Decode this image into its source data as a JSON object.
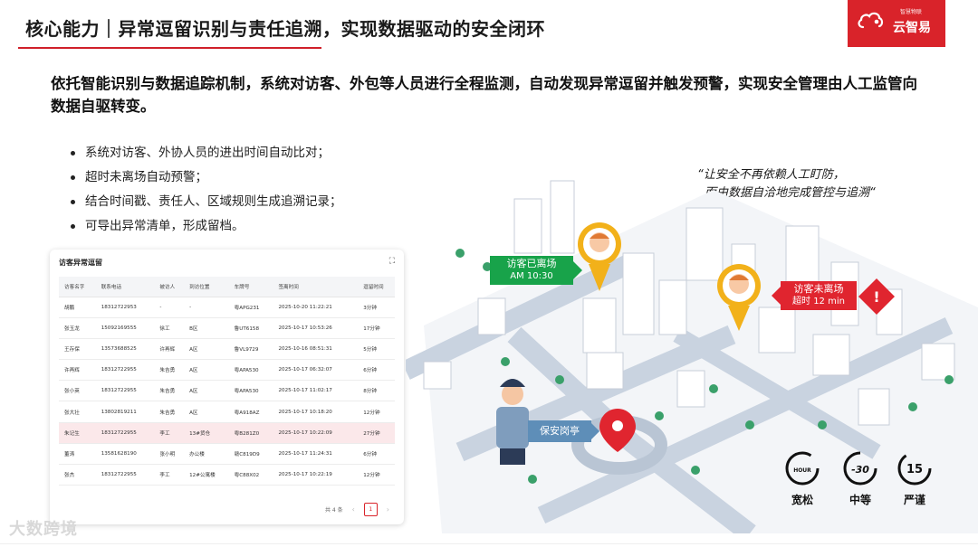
{
  "header": {
    "title": "核心能力｜异常逗留识别与责任追溯，实现数据驱动的安全闭环",
    "logo_tag": "智慧物联",
    "logo_name": "云智易"
  },
  "intro": "依托智能识别与数据追踪机制，系统对访客、外包等人员进行全程监测，自动发现异常逗留并触发预警，实现安全管理由人工监管向数据自驱转变。",
  "bullets": [
    "系统对访客、外协人员的进出时间自动比对；",
    "超时未离场自动预警；",
    "结合时间戳、责任人、区域规则生成追溯记录；",
    "可导出异常清单，形成留档。"
  ],
  "quote": {
    "line1": "“让安全不再依赖人工盯防，",
    "line2": "而由数据自洽地完成管控与追溯“"
  },
  "table_card": {
    "title": "访客异常逗留",
    "columns": [
      "访客名字",
      "联系电话",
      "被访人",
      "到访位置",
      "车牌号",
      "签离时间",
      "逗留时间"
    ],
    "rows": [
      [
        "胡鹏",
        "18312722953",
        "-",
        "-",
        "粤APG231",
        "2025-10-20 11:22:21",
        "3分钟"
      ],
      [
        "张玉龙",
        "15092169555",
        "徐工",
        "B区",
        "鲁UT6158",
        "2025-10-17 10:53:26",
        "17分钟"
      ],
      [
        "王存保",
        "13573688525",
        "许再辉",
        "A区",
        "鲁VL9729",
        "2025-10-16 08:51:31",
        "5分钟"
      ],
      [
        "许再辉",
        "18312722955",
        "朱吉勇",
        "A区",
        "粤APA530",
        "2025-10-17 06:32:07",
        "6分钟"
      ],
      [
        "张小英",
        "18312722955",
        "朱吉勇",
        "A区",
        "粤APA530",
        "2025-10-17 11:02:17",
        "8分钟"
      ],
      [
        "张大壮",
        "13802819211",
        "朱吉勇",
        "A区",
        "粤A918AZ",
        "2025-10-17 10:18:20",
        "12分钟"
      ],
      [
        "朱记生",
        "18312722955",
        "李工",
        "13#货仓",
        "粤B281Z0",
        "2025-10-17 10:22:09",
        "27分钟"
      ],
      [
        "董涛",
        "13581628190",
        "张小明",
        "办公楼",
        "赣C819D9",
        "2025-10-17 11:24:31",
        "6分钟"
      ],
      [
        "张杰",
        "18312722955",
        "李工",
        "12#公寓楼",
        "粤C88X02",
        "2025-10-17 10:22:19",
        "12分钟"
      ]
    ],
    "highlight_row": 6,
    "pager": {
      "total": "共 4 条",
      "prev": "‹",
      "current": "1",
      "next": "›"
    }
  },
  "map": {
    "visitor_left": {
      "title": "访客已离场",
      "time": "AM 10:30"
    },
    "visitor_stay": {
      "title": "访客未离场",
      "time": "超时 12 min"
    },
    "guard": "保安岗亭"
  },
  "levels": [
    {
      "label": "宽松",
      "icon": "one-hour-icon",
      "badge": "HOUR"
    },
    {
      "label": "中等",
      "icon": "thirty-minutes-icon",
      "badge": "-30"
    },
    {
      "label": "严谨",
      "icon": "fifteen-minutes-icon",
      "badge": "15"
    }
  ],
  "watermark": "大数跨境",
  "colors": {
    "brand_red": "#d9232a",
    "green": "#18a34a",
    "alert_red": "#e0252f",
    "guard_blue": "#5e8eb8"
  }
}
